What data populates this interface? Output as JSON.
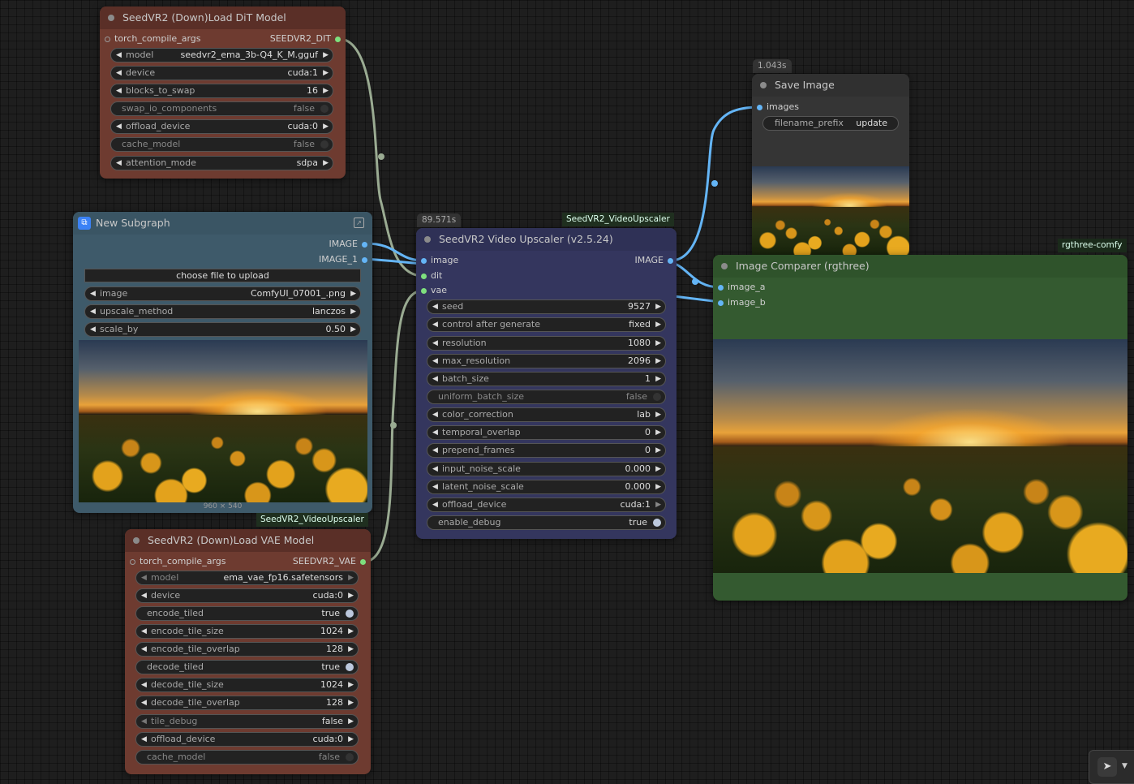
{
  "colors": {
    "dit_node": "#6e3b30",
    "vae_node": "#6e3b30",
    "subgraph": "#3e5a6a",
    "upscaler": "#34365e",
    "save": "#353535",
    "comparer": "#345a30",
    "wire_image": "#64b5f6",
    "wire_model": "#9aab92"
  },
  "icons": [
    "subgraph-icon",
    "expand-icon",
    "cursor-icon",
    "chevron-down-icon"
  ],
  "dit": {
    "title": "SeedVR2 (Down)Load DiT Model",
    "input": "torch_compile_args",
    "output": "SEEDVR2_DIT",
    "widgets": [
      {
        "label": "model",
        "value": "seedvr2_ema_3b-Q4_K_M.gguf"
      },
      {
        "label": "device",
        "value": "cuda:1"
      },
      {
        "label": "blocks_to_swap",
        "value": "16"
      },
      {
        "label": "swap_io_components",
        "value": "false"
      },
      {
        "label": "offload_device",
        "value": "cuda:0"
      },
      {
        "label": "cache_model",
        "value": "false"
      },
      {
        "label": "attention_mode",
        "value": "sdpa"
      }
    ]
  },
  "subgraph": {
    "title": "New Subgraph",
    "outputs": [
      "IMAGE",
      "IMAGE_1"
    ],
    "upload_label": "choose file to upload",
    "widgets": [
      {
        "label": "image",
        "value": "ComfyUI_07001_.png"
      },
      {
        "label": "upscale_method",
        "value": "lanczos"
      },
      {
        "label": "scale_by",
        "value": "0.50"
      }
    ],
    "image_size": "960 × 540",
    "tag": "SeedVR2_VideoUpscaler"
  },
  "vae": {
    "title": "SeedVR2 (Down)Load VAE Model",
    "input": "torch_compile_args",
    "output": "SEEDVR2_VAE",
    "widgets": [
      {
        "label": "model",
        "value": "ema_vae_fp16.safetensors"
      },
      {
        "label": "device",
        "value": "cuda:0"
      },
      {
        "label": "encode_tiled",
        "value": "true"
      },
      {
        "label": "encode_tile_size",
        "value": "1024"
      },
      {
        "label": "encode_tile_overlap",
        "value": "128"
      },
      {
        "label": "decode_tiled",
        "value": "true"
      },
      {
        "label": "decode_tile_size",
        "value": "1024"
      },
      {
        "label": "decode_tile_overlap",
        "value": "128"
      },
      {
        "label": "tile_debug",
        "value": "false"
      },
      {
        "label": "offload_device",
        "value": "cuda:0"
      },
      {
        "label": "cache_model",
        "value": "false"
      }
    ]
  },
  "upscaler": {
    "badge": "89.571s",
    "tag": "SeedVR2_VideoUpscaler",
    "title": "SeedVR2 Video Upscaler (v2.5.24)",
    "inputs": [
      "image",
      "dit",
      "vae"
    ],
    "output": "IMAGE",
    "widgets": [
      {
        "label": "seed",
        "value": "9527"
      },
      {
        "label": "control after generate",
        "value": "fixed"
      },
      {
        "label": "resolution",
        "value": "1080"
      },
      {
        "label": "max_resolution",
        "value": "2096"
      },
      {
        "label": "batch_size",
        "value": "1"
      },
      {
        "label": "uniform_batch_size",
        "value": "false"
      },
      {
        "label": "color_correction",
        "value": "lab"
      },
      {
        "label": "temporal_overlap",
        "value": "0"
      },
      {
        "label": "prepend_frames",
        "value": "0"
      },
      {
        "label": "input_noise_scale",
        "value": "0.000"
      },
      {
        "label": "latent_noise_scale",
        "value": "0.000"
      },
      {
        "label": "offload_device",
        "value": "cuda:1"
      },
      {
        "label": "enable_debug",
        "value": "true"
      }
    ]
  },
  "save": {
    "badge": "1.043s",
    "title": "Save Image",
    "input": "images",
    "widget": {
      "label": "filename_prefix",
      "value": "update"
    }
  },
  "comparer": {
    "tag": "rgthree-comfy",
    "title": "Image Comparer (rgthree)",
    "inputs": [
      "image_a",
      "image_b"
    ]
  }
}
